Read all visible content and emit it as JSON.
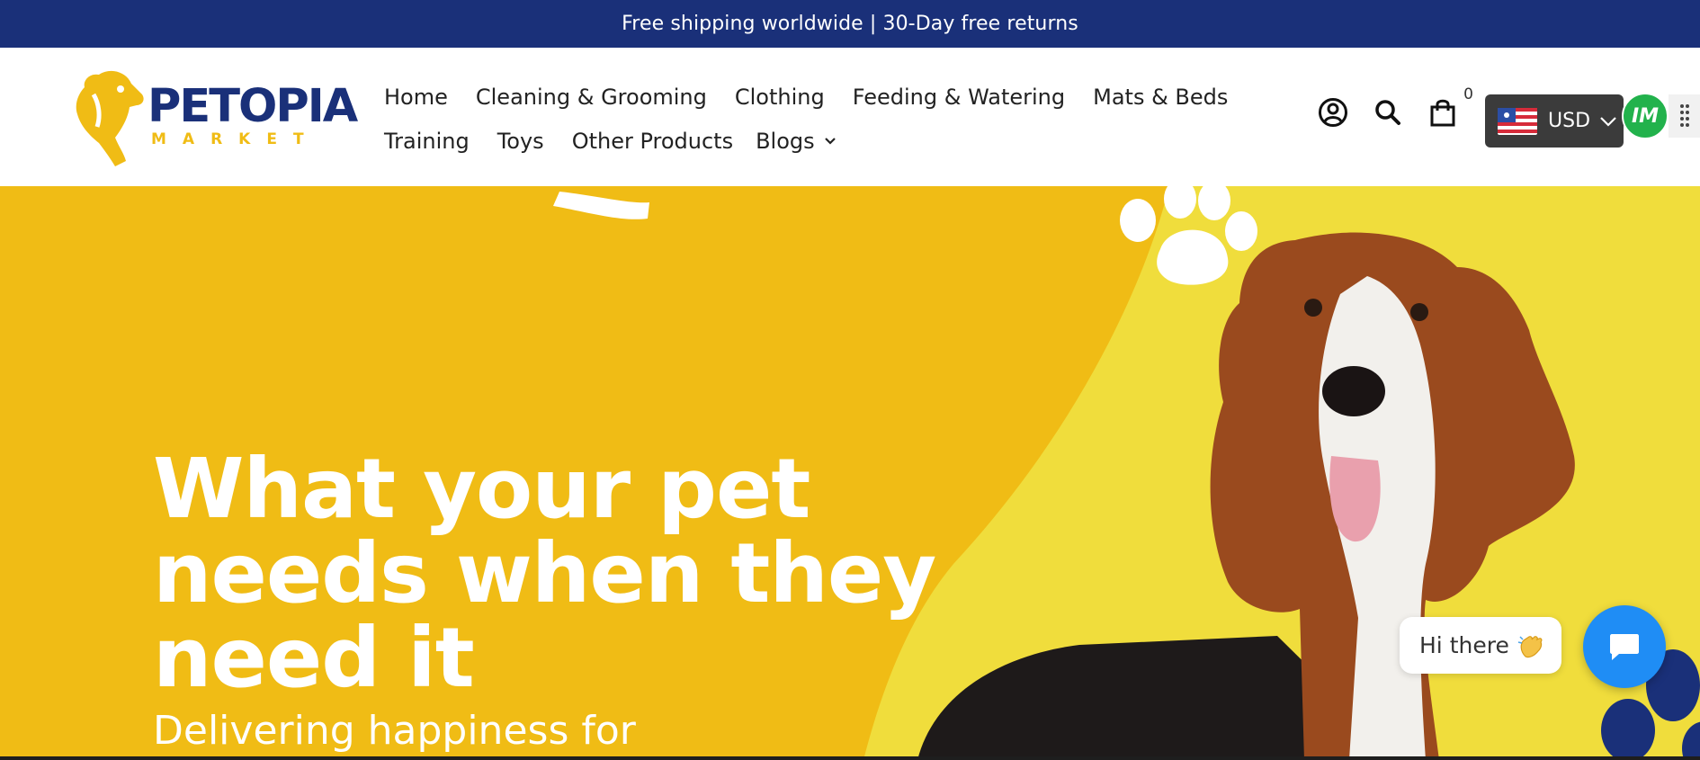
{
  "announcement": {
    "text": "Free shipping worldwide | 30-Day free returns"
  },
  "brand": {
    "name": "PETOPIA",
    "tagline": "MARKET",
    "primary_color": "#1a3079",
    "accent_color": "#f0bc15"
  },
  "nav": {
    "row1": [
      {
        "label": "Home"
      },
      {
        "label": "Cleaning & Grooming"
      },
      {
        "label": "Clothing"
      },
      {
        "label": "Feeding & Watering"
      },
      {
        "label": "Mats & Beds"
      }
    ],
    "row2": [
      {
        "label": "Training"
      },
      {
        "label": "Toys"
      },
      {
        "label": "Other Products"
      },
      {
        "label": "Blogs",
        "icon": "chevron-down-icon"
      }
    ]
  },
  "header_icons": {
    "account": "account-icon",
    "search": "search-icon",
    "cart": "cart-icon",
    "cart_count": "0"
  },
  "currency": {
    "selected": "USD",
    "flag": "us-flag-icon"
  },
  "app_badge": {
    "text": "IM"
  },
  "hero": {
    "headline_lines": [
      "What your pet",
      "needs when they",
      "need it"
    ],
    "subheadline": "Delivering happiness for",
    "background_color": "#f0bc15",
    "secondary_color": "#f0dd3c"
  },
  "chat": {
    "greeting": "Hi there",
    "wave_icon": "waving-hand-icon",
    "button_icon": "chat-bubble-icon",
    "button_color": "#1f8df5"
  }
}
